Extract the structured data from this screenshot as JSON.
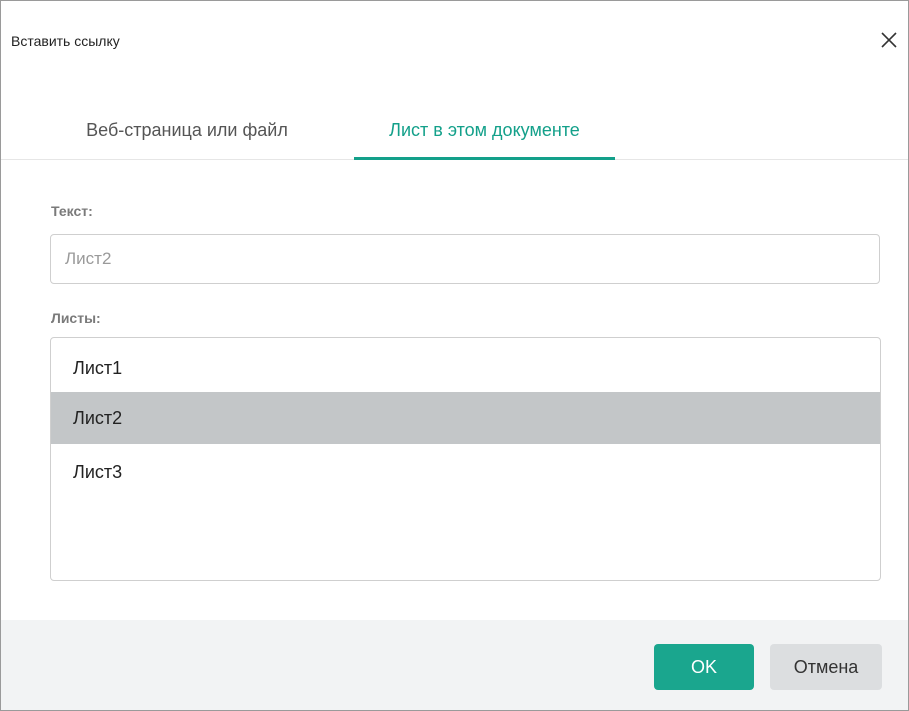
{
  "dialog": {
    "title": "Вставить ссылку",
    "close_icon": "close-icon"
  },
  "tabs": [
    {
      "label": "Веб-страница или файл",
      "active": false
    },
    {
      "label": "Лист в этом документе",
      "active": true
    }
  ],
  "form": {
    "text_label": "Текст:",
    "text_value": "Лист2",
    "sheets_label": "Листы:",
    "sheets": [
      {
        "label": "Лист1",
        "selected": false
      },
      {
        "label": "Лист2",
        "selected": true
      },
      {
        "label": "Лист3",
        "selected": false
      }
    ]
  },
  "footer": {
    "ok_label": "OK",
    "cancel_label": "Отмена"
  },
  "colors": {
    "accent": "#13a08a",
    "ok_button": "#1aa68e",
    "selected_row": "#c3c6c8",
    "footer_bg": "#f2f3f4"
  }
}
